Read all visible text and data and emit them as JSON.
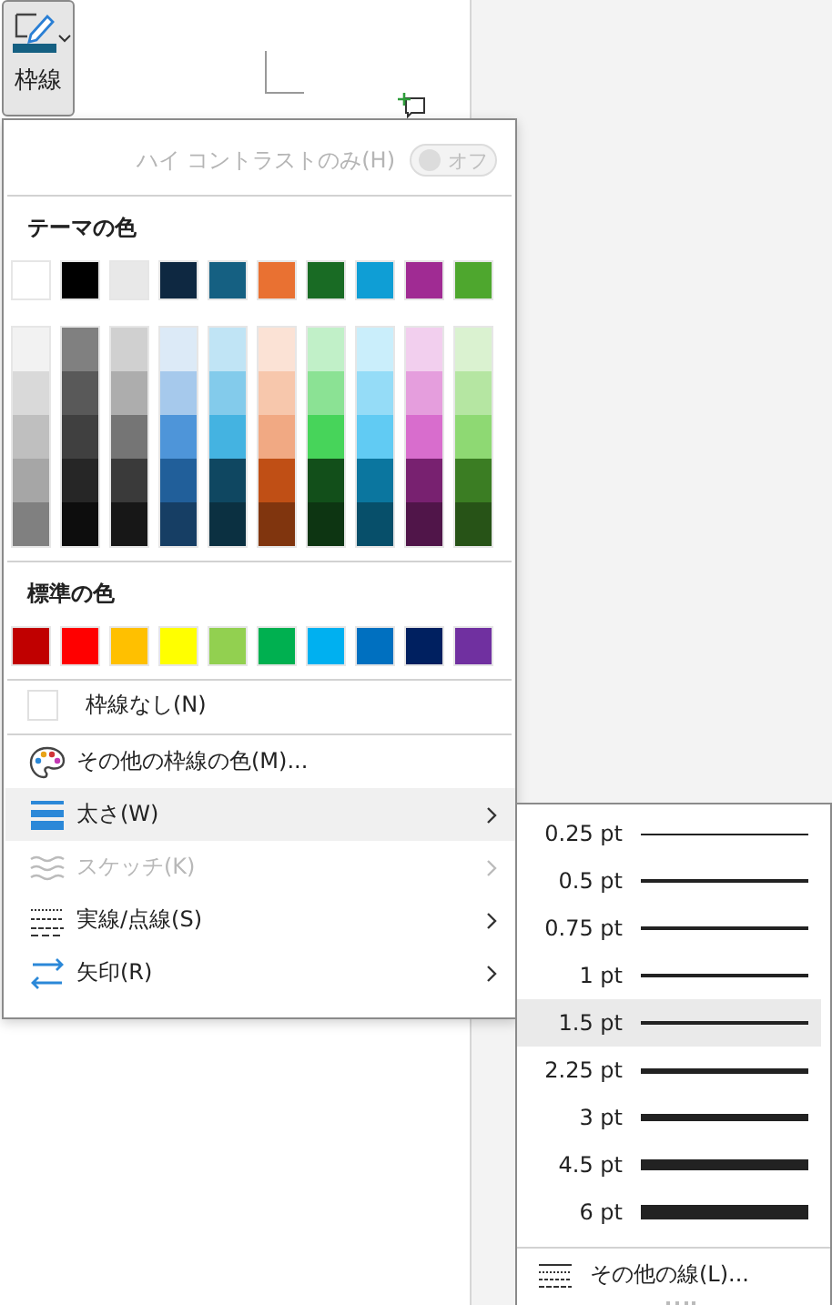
{
  "ribbon_button": {
    "label": "枠線",
    "pressed": true,
    "color": "#156082"
  },
  "border_menu": {
    "high_contrast": {
      "label": "ハイ コントラストのみ(H)",
      "toggle_label": "オフ",
      "on": false,
      "disabled": true
    },
    "theme_colors": {
      "title": "テーマの色",
      "main": [
        {
          "color": "#ffffff"
        },
        {
          "color": "#000000"
        },
        {
          "color": "#e8e8e8"
        },
        {
          "color": "#0e2841"
        },
        {
          "color": "#156082"
        },
        {
          "color": "#e97132"
        },
        {
          "color": "#196b24"
        },
        {
          "color": "#0f9ed5"
        },
        {
          "color": "#a02b93"
        },
        {
          "color": "#4ea72e"
        }
      ],
      "shade_columns": [
        {
          "swatches": [
            {
              "color": "#f2f2f2"
            },
            {
              "color": "#d9d9d9"
            },
            {
              "color": "#bfbfbf"
            },
            {
              "color": "#a6a6a6"
            },
            {
              "color": "#808080"
            }
          ]
        },
        {
          "swatches": [
            {
              "color": "#808080"
            },
            {
              "color": "#595959"
            },
            {
              "color": "#404040"
            },
            {
              "color": "#262626"
            },
            {
              "color": "#0d0d0d"
            }
          ]
        },
        {
          "swatches": [
            {
              "color": "#d0d0d0"
            },
            {
              "color": "#adadad"
            },
            {
              "color": "#757575"
            },
            {
              "color": "#3a3a3a"
            },
            {
              "color": "#171717"
            }
          ]
        },
        {
          "swatches": [
            {
              "color": "#dceaf7"
            },
            {
              "color": "#a6c9ec"
            },
            {
              "color": "#4e95d9"
            },
            {
              "color": "#215f9a"
            },
            {
              "color": "#163e64"
            }
          ]
        },
        {
          "swatches": [
            {
              "color": "#c0e4f5"
            },
            {
              "color": "#83cbeb"
            },
            {
              "color": "#44b3e1"
            },
            {
              "color": "#0f4761"
            },
            {
              "color": "#0b3041"
            }
          ]
        },
        {
          "swatches": [
            {
              "color": "#fbe2d5"
            },
            {
              "color": "#f7c7ac"
            },
            {
              "color": "#f1a983"
            },
            {
              "color": "#c04f15"
            },
            {
              "color": "#80350e"
            }
          ]
        },
        {
          "swatches": [
            {
              "color": "#c1f0c8"
            },
            {
              "color": "#8be294"
            },
            {
              "color": "#47d45a"
            },
            {
              "color": "#124f1a"
            },
            {
              "color": "#0d3512"
            }
          ]
        },
        {
          "swatches": [
            {
              "color": "#caeefb"
            },
            {
              "color": "#95dcf7"
            },
            {
              "color": "#61cbf3"
            },
            {
              "color": "#0b769f"
            },
            {
              "color": "#074f6a"
            }
          ]
        },
        {
          "swatches": [
            {
              "color": "#f2cfee"
            },
            {
              "color": "#e59edd"
            },
            {
              "color": "#d86dcd"
            },
            {
              "color": "#782170"
            },
            {
              "color": "#501549"
            }
          ]
        },
        {
          "swatches": [
            {
              "color": "#daf2d0"
            },
            {
              "color": "#b5e6a2"
            },
            {
              "color": "#8ed973"
            },
            {
              "color": "#3b7d23"
            },
            {
              "color": "#275317"
            }
          ]
        }
      ]
    },
    "standard_colors": {
      "title": "標準の色",
      "swatches": [
        {
          "color": "#c00000"
        },
        {
          "color": "#ff0000"
        },
        {
          "color": "#ffc000"
        },
        {
          "color": "#ffff00"
        },
        {
          "color": "#92d050"
        },
        {
          "color": "#00b050"
        },
        {
          "color": "#00b0f0"
        },
        {
          "color": "#0070c0"
        },
        {
          "color": "#002060"
        },
        {
          "color": "#7030a0"
        }
      ]
    },
    "no_border": {
      "label": "枠線なし(N)",
      "checked": false
    },
    "items": [
      {
        "kind": "palette",
        "label": "その他の枠線の色(M)...",
        "highlighted": false,
        "disabled": false,
        "submenu": false
      },
      {
        "kind": "weight",
        "label": "太さ(W)",
        "highlighted": true,
        "disabled": false,
        "submenu": true
      },
      {
        "kind": "sketch",
        "label": "スケッチ(K)",
        "highlighted": false,
        "disabled": true,
        "submenu": true
      },
      {
        "kind": "dash",
        "label": "実線/点線(S)",
        "highlighted": false,
        "disabled": false,
        "submenu": true
      },
      {
        "kind": "arrow",
        "label": "矢印(R)",
        "highlighted": false,
        "disabled": false,
        "submenu": true
      }
    ]
  },
  "weight_submenu": {
    "weights": [
      {
        "label": "0.25 pt",
        "selected": false
      },
      {
        "label": "0.5 pt",
        "selected": false
      },
      {
        "label": "0.75 pt",
        "selected": false
      },
      {
        "label": "1 pt",
        "selected": false
      },
      {
        "label": "1.5 pt",
        "selected": true
      },
      {
        "label": "2.25 pt",
        "selected": false
      },
      {
        "label": "3 pt",
        "selected": false
      },
      {
        "label": "4.5 pt",
        "selected": false
      },
      {
        "label": "6 pt",
        "selected": false
      }
    ],
    "more": {
      "label": "その他の線(L)..."
    }
  }
}
